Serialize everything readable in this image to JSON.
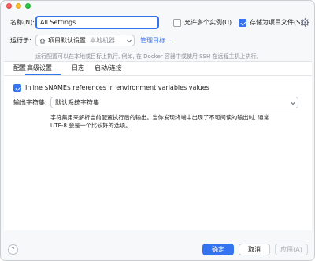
{
  "window": {
    "controls": [
      "close",
      "minimize",
      "maximize"
    ]
  },
  "name": {
    "label": "名称(N):",
    "value": "All Settings"
  },
  "options": {
    "allow_multiple": {
      "label": "允许多个实例(U)",
      "checked": false
    },
    "store_as_project_file": {
      "label": "存储为项目文件(S)",
      "checked": true
    }
  },
  "run_on": {
    "label": "运行于:",
    "target_main": "项目默认设置",
    "target_sub": "本地机器",
    "manage_link": "管理目标...",
    "hint": "运行配置可以在本地或目标上执行, 例如, 在 Docker 容器中或使用 SSH 在远程主机上执行。"
  },
  "tabs": [
    {
      "label": "配置",
      "active": false
    },
    {
      "label": "高级设置",
      "active": true
    },
    {
      "label": "日志",
      "active": false
    },
    {
      "label": "启动/连接",
      "active": false
    }
  ],
  "advanced": {
    "inline_names": {
      "label": "Inline $NAME$ references in environment variables values",
      "checked": true
    },
    "output_charset": {
      "label": "输出字符集:",
      "value": "默认系统字符集",
      "description_line1": "字符集用来解析当前配置执行后的输出。当你发现终端中出现了不可阅读的输出时, 通常",
      "description_line2": "UTF-8 会是一个比较好的选项。"
    }
  },
  "footer": {
    "help": "?",
    "ok": "确定",
    "cancel": "取消",
    "apply": "应用(A)"
  },
  "colors": {
    "accent": "#3574f0",
    "window_bg": "#f7f8fa",
    "panel_bg": "#ffffff"
  }
}
